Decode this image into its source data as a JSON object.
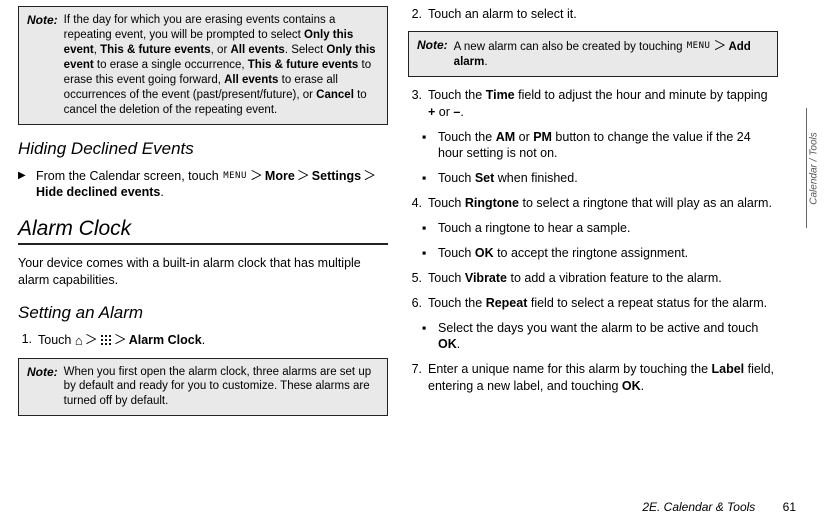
{
  "left": {
    "note1": {
      "label": "Note:",
      "text_before": "If the day for which you are erasing events contains a repeating event, you will be prompted to select ",
      "b1": "Only this event",
      "sep1": ", ",
      "b2": "This & future events",
      "sep2": ", or ",
      "b3": "All events",
      "sep3": ". Select ",
      "b4": "Only this event",
      "sep4": " to erase a single occurrence, ",
      "b5": "This & future events",
      "sep5": " to erase this event going forward, ",
      "b6": "All events",
      "sep6": " to erase all occurrences of the event (past/present/future), or ",
      "b7": "Cancel",
      "sep7": " to cancel the deletion of the repeating event."
    },
    "h_hiding": "Hiding Declined Events",
    "tri": {
      "t1": "From the Calendar screen, touch ",
      "b1": "More",
      "b2": "Settings",
      "b3": "Hide declined events",
      "period": "."
    },
    "h_alarm": "Alarm Clock",
    "intro": "Your device comes with a built-in alarm clock that has multiple alarm capabilities.",
    "h_setting": "Setting an Alarm",
    "step1": {
      "num": "1.",
      "t1": "Touch ",
      "b1": "Alarm Clock",
      "period": "."
    },
    "note2": {
      "label": "Note:",
      "text": "When you first open the alarm clock, three alarms are set up by default and ready for you to customize. These alarms are turned off by default."
    }
  },
  "right": {
    "step2": {
      "num": "2.",
      "text": "Touch an alarm to select it."
    },
    "note3": {
      "label": "Note:",
      "t1": "A new alarm can also be created by touching ",
      "b1": "Add alarm",
      "period": "."
    },
    "step3": {
      "num": "3.",
      "t1": "Touch the ",
      "b1": "Time",
      "t2": " field to adjust the hour and minute by tapping ",
      "b2": "+",
      "t3": " or ",
      "b3": "–",
      "period": "."
    },
    "sub3a": {
      "t1": "Touch the ",
      "b1": "AM",
      "t2": " or ",
      "b2": "PM",
      "t3": " button to change the value if the 24 hour setting is not on."
    },
    "sub3b": {
      "t1": "Touch ",
      "b1": "Set",
      "t2": " when finished."
    },
    "step4": {
      "num": "4.",
      "t1": "Touch ",
      "b1": "Ringtone",
      "t2": " to select a ringtone that will play as an alarm."
    },
    "sub4a": {
      "t1": "Touch a ringtone to hear a sample."
    },
    "sub4b": {
      "t1": "Touch ",
      "b1": "OK",
      "t2": " to accept the ringtone assignment."
    },
    "step5": {
      "num": "5.",
      "t1": "Touch ",
      "b1": "Vibrate",
      "t2": " to add a vibration feature to the alarm."
    },
    "step6": {
      "num": "6.",
      "t1": "Touch the ",
      "b1": "Repeat",
      "t2": " field to select a repeat status for the alarm."
    },
    "sub6a": {
      "t1": "Select the days you want the alarm to be active and touch ",
      "b1": "OK",
      "period": "."
    },
    "step7": {
      "num": "7.",
      "t1": "Enter a unique name for this alarm by touching the ",
      "b1": "Label",
      "t2": " field, entering a new label, and touching ",
      "b2": "OK",
      "period": "."
    }
  },
  "sideTab": "Calendar / Tools",
  "footer": {
    "section": "2E. Calendar & Tools",
    "page": "61"
  }
}
